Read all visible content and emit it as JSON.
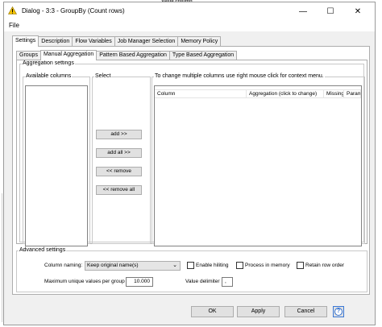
{
  "background": {
    "top_text": "Value column"
  },
  "window": {
    "title": "Dialog - 3:3 - GroupBy (Count rows)",
    "controls": {
      "minimize": "—",
      "maximize": "☐",
      "close": "✕"
    }
  },
  "menu": {
    "file": "File"
  },
  "tabs": [
    {
      "label": "Settings"
    },
    {
      "label": "Description"
    },
    {
      "label": "Flow Variables"
    },
    {
      "label": "Job Manager Selection"
    },
    {
      "label": "Memory Policy"
    }
  ],
  "inner_tabs": [
    {
      "label": "Groups"
    },
    {
      "label": "Manual Aggregation"
    },
    {
      "label": "Pattern Based Aggregation"
    },
    {
      "label": "Type Based Aggregation"
    }
  ],
  "aggregation": {
    "legend": "Aggregation settings",
    "available_columns_legend": "Available columns",
    "select_legend": "Select",
    "context_legend": "To change multiple columns use right mouse click for context menu.",
    "buttons": {
      "add": "add >>",
      "add_all": "add all >>",
      "remove": "<< remove",
      "remove_all": "<< remove all"
    },
    "table_headers": [
      "Column",
      "Aggregation (click to change)",
      "Missing",
      "Parameter"
    ]
  },
  "advanced": {
    "legend": "Advanced settings",
    "column_naming_label": "Column naming:",
    "column_naming_value": "Keep original name(s)",
    "enable_hiliting": "Enable hiliting",
    "process_in_memory": "Process in memory",
    "retain_row_order": "Retain row order",
    "max_unique_label": "Maximum unique values per group",
    "max_unique_value": "10.000",
    "value_delimiter_label": "Value delimiter",
    "value_delimiter_value": ","
  },
  "footer": {
    "ok": "OK",
    "apply": "Apply",
    "cancel": "Cancel",
    "help": "?"
  },
  "colors": {
    "help_accent": "#2f6fd0",
    "warning_icon": "#f5c400"
  }
}
